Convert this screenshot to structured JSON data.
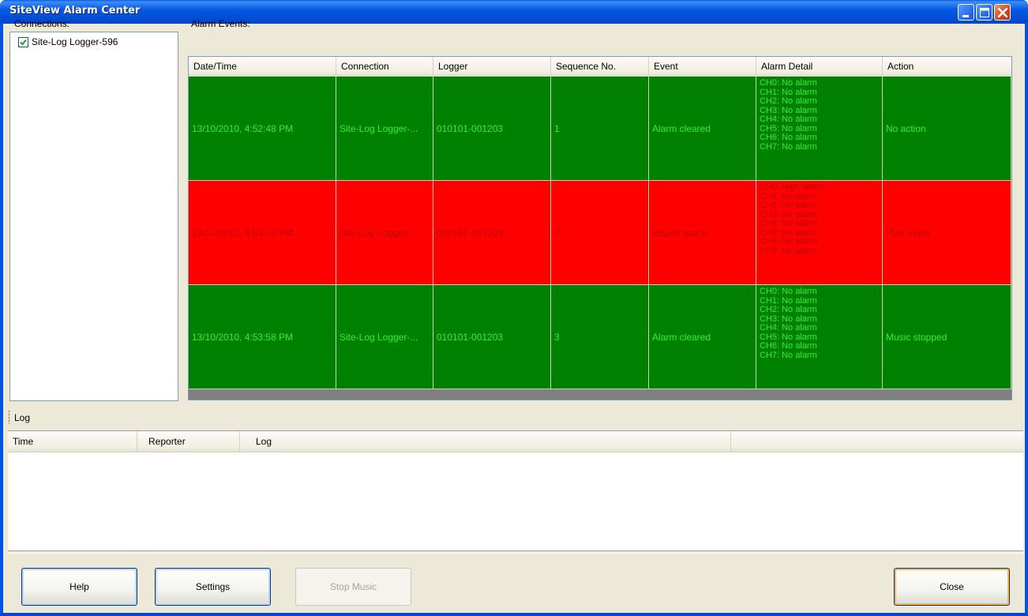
{
  "window": {
    "title": "SiteView Alarm Center"
  },
  "connections": {
    "label": "Connections:",
    "items": [
      {
        "label": "Site-Log Logger-596",
        "checked": true
      }
    ]
  },
  "alarm_events": {
    "label": "Alarm Events:",
    "columns": [
      "Date/Time",
      "Connection",
      "Logger",
      "Sequence No.",
      "Event",
      "Alarm Detail",
      "Action"
    ],
    "rows": [
      {
        "datetime": "13/10/2010, 4:52:48 PM",
        "connection": "Site-Log Logger-...",
        "logger": "010101-001203",
        "sequence": "1",
        "event": "Alarm cleared",
        "details": [
          "CH0: No alarm",
          "CH1: No alarm",
          "CH2: No alarm",
          "CH3: No alarm",
          "CH4: No alarm",
          "CH5: No alarm",
          "CH6: No alarm",
          "CH7: No alarm"
        ],
        "action": "No action",
        "bg_color": "#008000",
        "text_color": "#33ee33"
      },
      {
        "datetime": "13/10/2010, 4:53:24 PM",
        "connection": "Site-Log Logger-...",
        "logger": "010101-001203",
        "sequence": "2",
        "event": "Report alarm",
        "details": [
          "CH0: High alarm",
          "CH1: No alarm",
          "CH2: No alarm",
          "CH3: No alarm",
          "CH4: No alarm",
          "CH5: No alarm",
          "CH6: No alarm",
          "CH7: No alarm"
        ],
        "action": "Play music",
        "bg_color": "#ff0000",
        "text_color": "#b80000"
      },
      {
        "datetime": "13/10/2010, 4:53:58 PM",
        "connection": "Site-Log Logger-...",
        "logger": "010101-001203",
        "sequence": "3",
        "event": "Alarm cleared",
        "details": [
          "CH0: No alarm",
          "CH1: No alarm",
          "CH2: No alarm",
          "CH3: No alarm",
          "CH4: No alarm",
          "CH5: No alarm",
          "CH6: No alarm",
          "CH7: No alarm"
        ],
        "action": "Music stopped",
        "bg_color": "#008000",
        "text_color": "#33ee33"
      }
    ]
  },
  "log": {
    "label": "Log",
    "columns": [
      "Time",
      "Reporter",
      "Log"
    ]
  },
  "buttons": {
    "help": "Help",
    "settings": "Settings",
    "stop_music": "Stop Music",
    "close": "Close"
  },
  "icons": {
    "minimize": "minimize-icon",
    "maximize": "maximize-icon",
    "close": "close-icon",
    "checkbox": "checkmark-icon"
  }
}
